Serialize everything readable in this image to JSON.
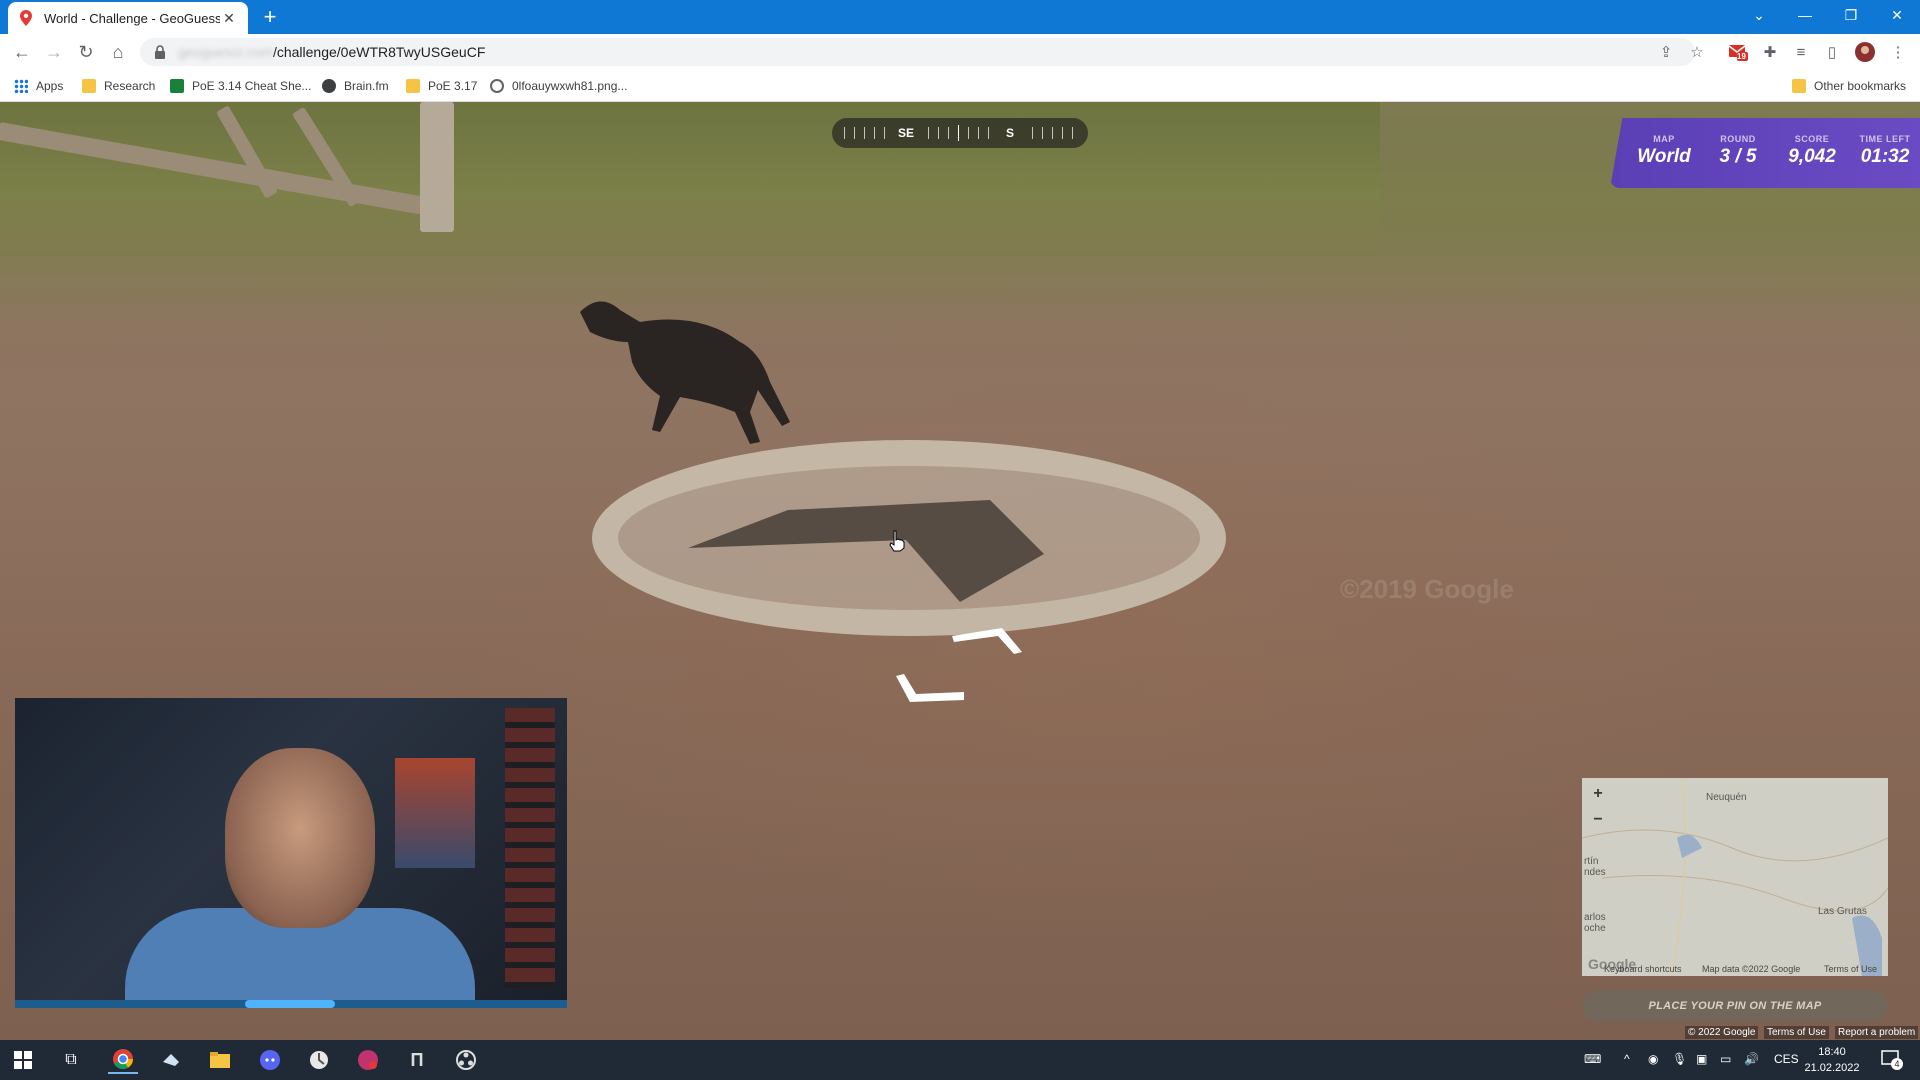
{
  "browser": {
    "tab": {
      "title": "World - Challenge - GeoGuessr"
    },
    "address": {
      "url_hidden": "geoguessr.com",
      "url_visible": "/challenge/0eWTR8TwyUSGeuCF"
    },
    "bookmarks": [
      {
        "label": "Apps"
      },
      {
        "label": "Research"
      },
      {
        "label": "PoE 3.14 Cheat She..."
      },
      {
        "label": "Brain.fm"
      },
      {
        "label": "PoE 3.17"
      },
      {
        "label": "0lfoauywxwh81.png..."
      }
    ],
    "other_bookmarks": "Other bookmarks",
    "gmail_badge": "19"
  },
  "game": {
    "compass": {
      "labels": [
        "SE",
        "S"
      ]
    },
    "hud": {
      "map_label": "MAP",
      "map_value": "World",
      "round_label": "ROUND",
      "round_value": "3 / 5",
      "score_label": "SCORE",
      "score_value": "9,042",
      "time_label": "TIME LEFT",
      "time_value": "01:32"
    },
    "watermark": "©2019 Google",
    "minimap": {
      "zoom_in": "+",
      "zoom_out": "−",
      "places": [
        "Neuquén",
        "rtín\nndes",
        "Las Grutas",
        "arlos\noche"
      ],
      "logo": "Google",
      "footer": [
        "Keyboard shortcuts",
        "Map data ©2022 Google",
        "Terms of Use"
      ]
    },
    "place_pin_button": "PLACE YOUR PIN ON THE MAP",
    "google_footer": [
      "© 2022 Google",
      "Terms of Use",
      "Report a problem"
    ]
  },
  "taskbar": {
    "language": "CES",
    "time": "18:40",
    "date": "21.02.2022",
    "notifications": "4"
  },
  "colors": {
    "chrome_blue": "#0f78d4",
    "hud_purple": "#5a3fb5",
    "taskbar": "#1f2a36"
  }
}
